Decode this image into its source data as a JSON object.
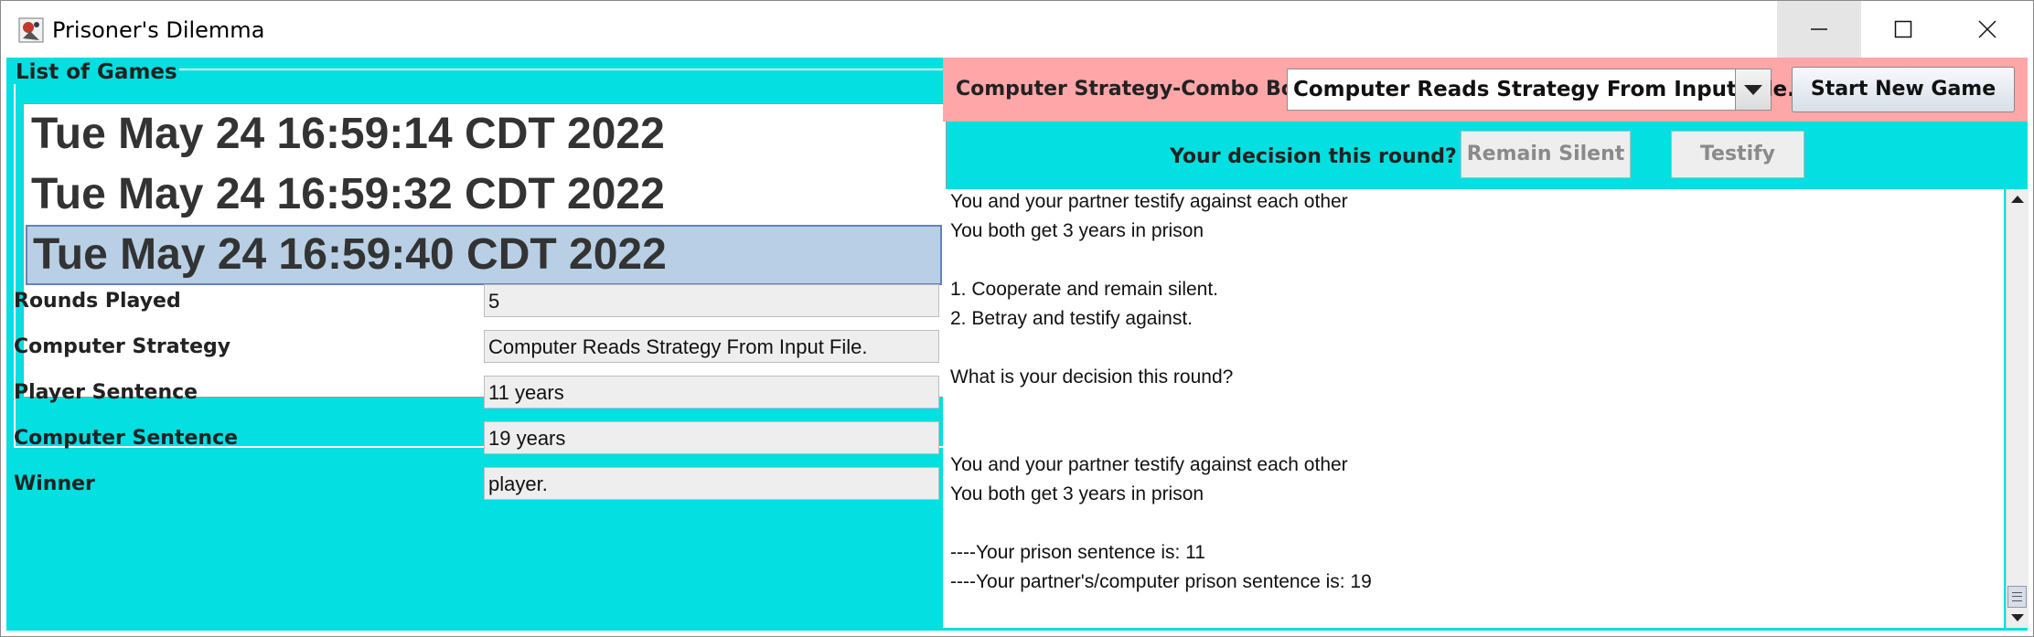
{
  "window": {
    "title": "Prisoner's Dilemma",
    "controls": {
      "minimize": "minimize-icon",
      "maximize": "maximize-icon",
      "close": "close-icon"
    }
  },
  "games": {
    "legend": "List of Games",
    "items": [
      {
        "label": "Tue May 24 16:59:14 CDT 2022",
        "selected": false
      },
      {
        "label": "Tue May 24 16:59:32 CDT 2022",
        "selected": false
      },
      {
        "label": "Tue May 24 16:59:40 CDT 2022",
        "selected": true
      }
    ]
  },
  "stats": [
    {
      "label": "Rounds Played",
      "value": "5"
    },
    {
      "label": "Computer Strategy",
      "value": "Computer Reads Strategy From Input File."
    },
    {
      "label": "Player Sentence",
      "value": "11 years"
    },
    {
      "label": "Computer Sentence",
      "value": "19 years"
    },
    {
      "label": "Winner",
      "value": "player."
    }
  ],
  "strategy": {
    "label": "Computer Strategy-Combo Box",
    "selected": "Computer Reads Strategy From Input File.",
    "start_button": "Start New Game"
  },
  "decision": {
    "prompt": "Your decision this round?",
    "remain_silent": "Remain Silent",
    "testify": "Testify"
  },
  "log": [
    "You and your partner testify against each other",
    "You both get 3 years in prison",
    "",
    "1. Cooperate and remain silent.",
    "2. Betray and testify against.",
    "",
    "What is your decision this round?",
    "",
    "",
    "You and your partner testify against each other",
    "You both get 3 years in prison",
    "",
    "----Your prison sentence is: 11",
    "----Your partner's/computer prison sentence is: 19"
  ],
  "colors": {
    "panel_bg": "#04dfe1",
    "strategy_bar_bg": "#ffa6a8",
    "selection_bg": "#b8cfe5"
  }
}
